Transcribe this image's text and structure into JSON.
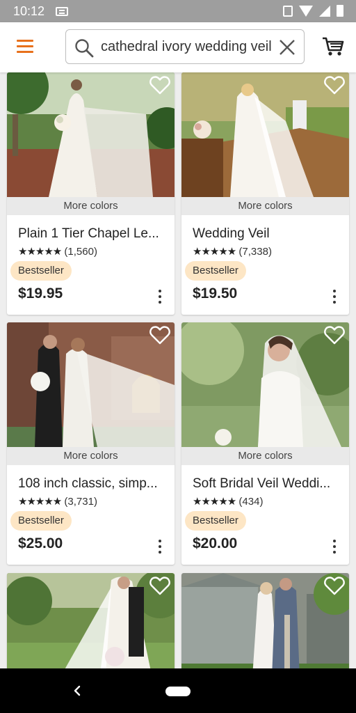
{
  "status_bar": {
    "time": "10:12"
  },
  "search": {
    "query": "cathedral ivory wedding veil"
  },
  "icons": {
    "menu": "hamburger-menu-icon",
    "search": "magnifier-icon",
    "clear": "close-x-icon",
    "cart": "shopping-cart-icon",
    "favorite": "heart-outline-icon",
    "more": "vertical-dots-icon"
  },
  "colors": {
    "accent": "#e8711c",
    "badge_bg": "#fde6c5",
    "more_colors_bg": "#e9e9e9"
  },
  "listings": [
    {
      "more_colors": "More colors",
      "title": "Plain 1 Tier Chapel Le...",
      "stars": "★★★★★",
      "reviews": "(1,560)",
      "badge": "Bestseller",
      "price": "$19.95"
    },
    {
      "more_colors": "More colors",
      "title": "Wedding Veil",
      "stars": "★★★★★",
      "reviews": "(7,338)",
      "badge": "Bestseller",
      "price": "$19.50"
    },
    {
      "more_colors": "More colors",
      "title": "108 inch classic, simp...",
      "stars": "★★★★★",
      "reviews": "(3,731)",
      "badge": "Bestseller",
      "price": "$25.00"
    },
    {
      "more_colors": "More colors",
      "title": "Soft Bridal Veil  Weddi...",
      "stars": "★★★★★",
      "reviews": "(434)",
      "badge": "Bestseller",
      "price": "$20.00"
    }
  ]
}
